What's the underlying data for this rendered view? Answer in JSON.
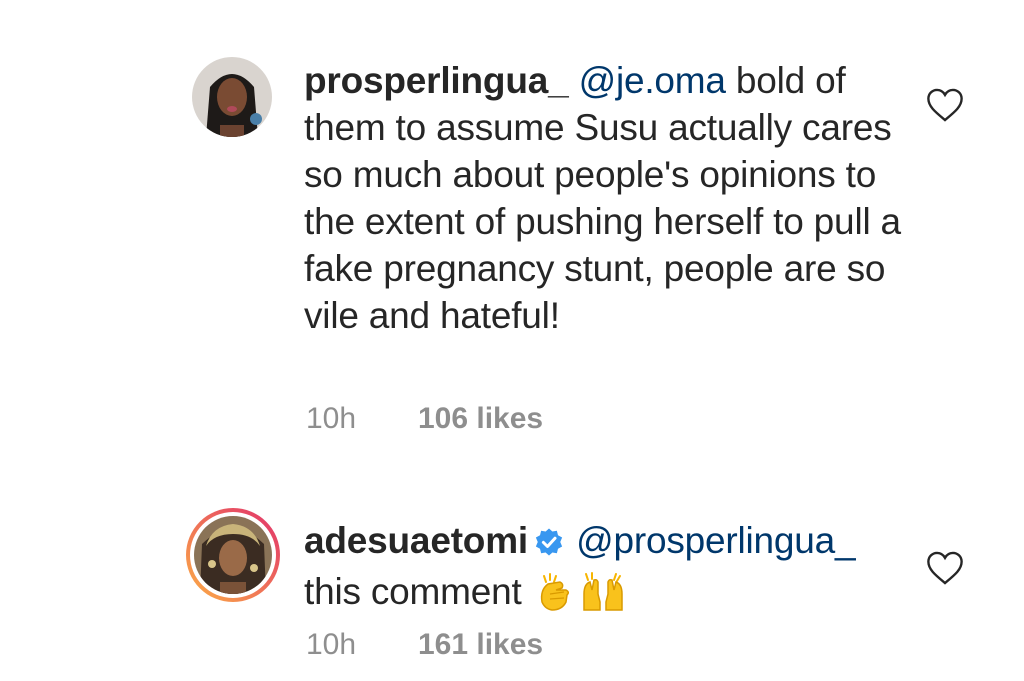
{
  "comments": [
    {
      "username": "prosperlingua_",
      "mention": "@je.oma",
      "text": " bold of them to assume Susu actually cares so much about people's opinions to the extent of pushing herself to pull a fake pregnancy stunt, people are so vile and hateful!",
      "time": "10h",
      "likes": "106 likes",
      "icon": "heart-outline-icon"
    },
    {
      "username": "adesuaetomi",
      "verified": true,
      "mention": "@prosperlingua_",
      "text": " this comment",
      "emojis": [
        "clapping-hands-emoji",
        "raising-hands-emoji"
      ],
      "time": "10h",
      "likes": "161 likes",
      "icon": "heart-outline-icon"
    }
  ],
  "colors": {
    "text": "#262626",
    "mention": "#00376b",
    "meta": "#8e8e8e",
    "verified": "#3897f0",
    "story_ring_start": "#fcaf45",
    "story_ring_end": "#e1306c"
  }
}
